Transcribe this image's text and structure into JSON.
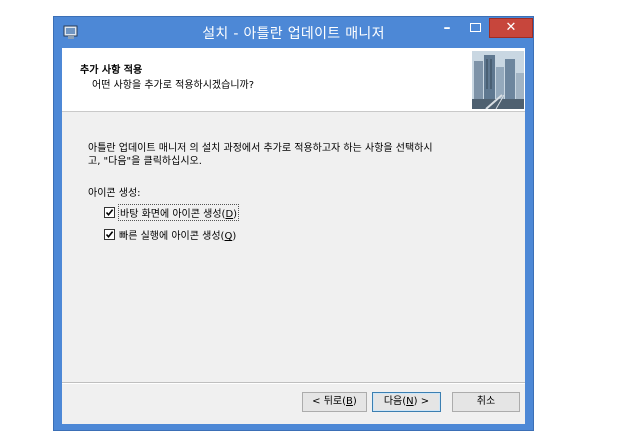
{
  "window": {
    "title": "설치 - 아틀란 업데이트 매니저",
    "minimize_glyph": "–",
    "close_glyph": "✕"
  },
  "header": {
    "title": "추가 사항 적용",
    "subtitle": "어떤 사항을 추가로 적용하시겠습니까?"
  },
  "body": {
    "instructions_line1": "아틀란 업데이트 매니저 의 설치 과정에서 추가로 적용하고자 하는 사항을 선택하시",
    "instructions_line2": "고, \"다음\"을 클릭하십시오.",
    "group_label": "아이콘 생성:",
    "options": [
      {
        "label": "바탕 화면에 아이콘 생성",
        "accel_pre": "(",
        "accel": "D",
        "accel_post": ")",
        "checked": true
      },
      {
        "label": "빠른 실행에 아이콘 생성",
        "accel_pre": "(",
        "accel": "Q",
        "accel_post": ")",
        "checked": true
      }
    ]
  },
  "buttons": {
    "back": {
      "pre": "< 뒤로(",
      "accel": "B",
      "post": ")"
    },
    "next": {
      "pre": "다음(",
      "accel": "N",
      "post": ") >"
    },
    "cancel": "취소"
  },
  "colors": {
    "titlebar": "#4d88d6",
    "close": "#c7463c",
    "client": "#f0f0f0"
  }
}
